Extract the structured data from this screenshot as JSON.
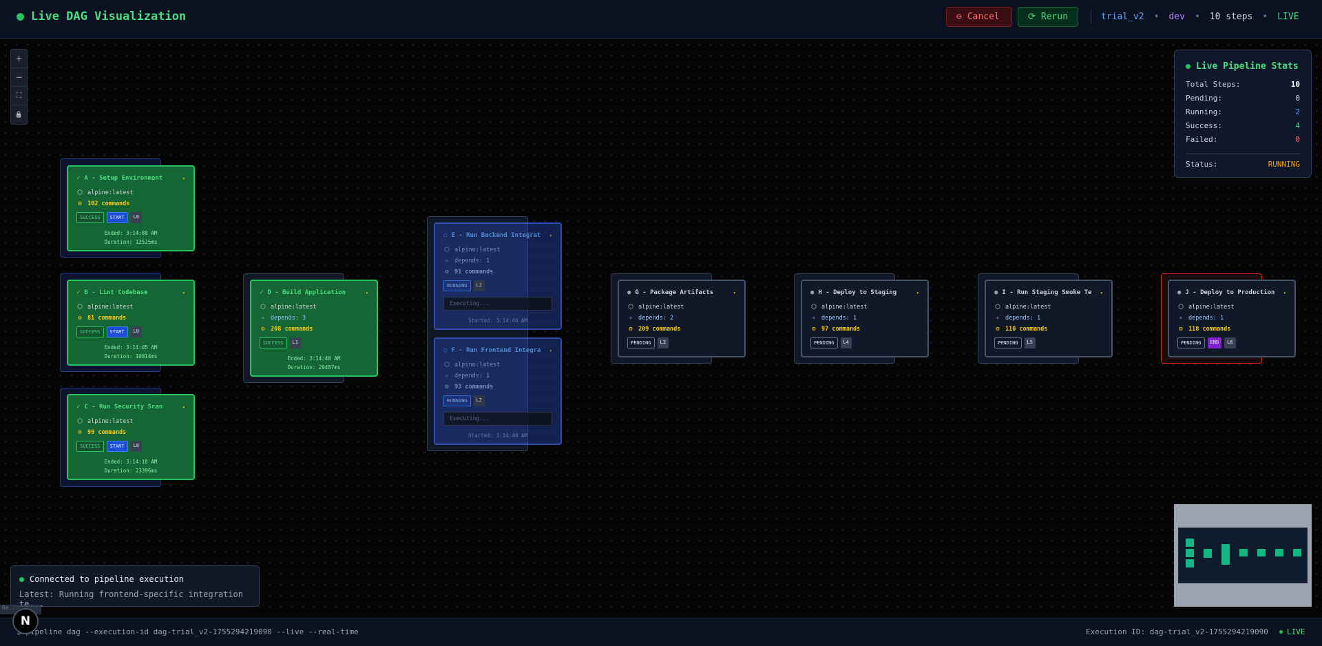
{
  "header": {
    "title": "Live DAG Visualization",
    "cancel_label": "Cancel",
    "rerun_label": "Rerun",
    "trial": "trial_v2",
    "env": "dev",
    "steps": "10 steps",
    "live": "LIVE",
    "separator": "•"
  },
  "zoom_controls": [
    "+",
    "−",
    "⛶",
    "🔒"
  ],
  "stats": {
    "title": "Live Pipeline Stats",
    "rows": [
      {
        "label": "Total Steps:",
        "value": "10",
        "color": "#ffffff"
      },
      {
        "label": "Pending:",
        "value": "0",
        "color": "#cbd5e1"
      },
      {
        "label": "Running:",
        "value": "2",
        "color": "#60a5fa"
      },
      {
        "label": "Success:",
        "value": "4",
        "color": "#4ade80"
      },
      {
        "label": "Failed:",
        "value": "0",
        "color": "#f87171"
      }
    ],
    "status_label": "Status:",
    "status_value": "RUNNING",
    "status_color": "#f59e0b"
  },
  "nodes": {
    "a": {
      "title": "A - Setup Environment",
      "image": "alpine:latest",
      "commands": "102 commands",
      "badges": [
        "SUCCESS",
        "START",
        "L0"
      ],
      "ended": "Ended: 3:14:08 AM",
      "duration": "Duration: 12525ms"
    },
    "b": {
      "title": "B - Lint Codebase",
      "image": "alpine:latest",
      "commands": "81 commands",
      "badges": [
        "SUCCESS",
        "START",
        "L0"
      ],
      "ended": "Ended: 3:14:05 AM",
      "duration": "Duration: 10814ms"
    },
    "c": {
      "title": "C - Run Security Scan",
      "image": "alpine:latest",
      "commands": "99 commands",
      "badges": [
        "SUCCESS",
        "START",
        "L0"
      ],
      "ended": "Ended: 3:14:18 AM",
      "duration": "Duration: 23396ms"
    },
    "d": {
      "title": "D - Build Application",
      "image": "alpine:latest",
      "depends": "depends: 3",
      "commands": "208 commands",
      "badges": [
        "SUCCESS",
        "L1"
      ],
      "ended": "Ended: 3:14:40 AM",
      "duration": "Duration: 20487ms"
    },
    "e": {
      "title": "E - Run Backend Integrat",
      "image": "alpine:latest",
      "depends": "depends: 1",
      "commands": "91 commands",
      "badges": [
        "RUNNING",
        "L2"
      ],
      "executing": "Executing...",
      "started": "Started: 3:14:40 AM"
    },
    "f": {
      "title": "F - Run Frontend Integra",
      "image": "alpine:latest",
      "depends": "depends: 1",
      "commands": "93 commands",
      "badges": [
        "RUNNING",
        "L2"
      ],
      "executing": "Executing...",
      "started": "Started: 3:14:40 AM"
    },
    "g": {
      "title": "G - Package Artifacts",
      "image": "alpine:latest",
      "depends": "depends: 2",
      "commands": "209 commands",
      "badges": [
        "PENDING",
        "L3"
      ]
    },
    "h": {
      "title": "H - Deploy to Staging",
      "image": "alpine:latest",
      "depends": "depends: 1",
      "commands": "97 commands",
      "badges": [
        "PENDING",
        "L4"
      ]
    },
    "i": {
      "title": "I - Run Staging Smoke Te",
      "image": "alpine:latest",
      "depends": "depends: 1",
      "commands": "110 commands",
      "badges": [
        "PENDING",
        "L5"
      ]
    },
    "j": {
      "title": "J - Deploy to Production",
      "image": "alpine:latest",
      "depends": "depends: 1",
      "commands": "118 commands",
      "badges": [
        "PENDING",
        "END",
        "L6"
      ]
    }
  },
  "toast": {
    "status": "Connected to pipeline execution",
    "latest": "Latest: Running frontend-specific integration te..."
  },
  "footer": {
    "command": "$ pipeline dag --execution-id dag-trial_v2-1755294219090 --live --real-time",
    "execution_id": "Execution ID: dag-trial_v2-1755294219090",
    "live": "LIVE"
  },
  "logo_letter": "N",
  "react_tag": "Re..."
}
